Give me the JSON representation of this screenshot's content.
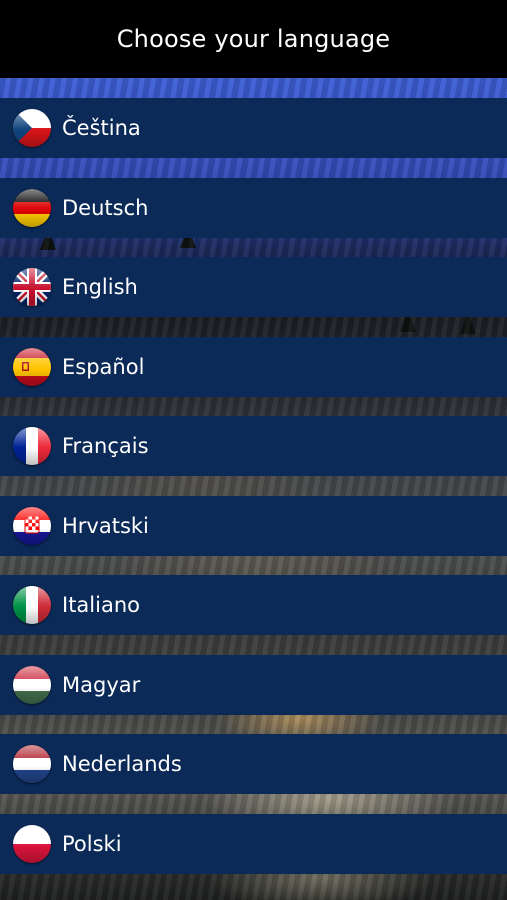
{
  "header": {
    "title": "Choose your language"
  },
  "languages": [
    {
      "label": "Čeština",
      "flag_icon": "czech-flag-icon"
    },
    {
      "label": "Deutsch",
      "flag_icon": "german-flag-icon"
    },
    {
      "label": "English",
      "flag_icon": "uk-flag-icon"
    },
    {
      "label": "Español",
      "flag_icon": "spanish-flag-icon"
    },
    {
      "label": "Français",
      "flag_icon": "french-flag-icon"
    },
    {
      "label": "Hrvatski",
      "flag_icon": "croatian-flag-icon"
    },
    {
      "label": "Italiano",
      "flag_icon": "italian-flag-icon"
    },
    {
      "label": "Magyar",
      "flag_icon": "hungarian-flag-icon"
    },
    {
      "label": "Nederlands",
      "flag_icon": "dutch-flag-icon"
    },
    {
      "label": "Polski",
      "flag_icon": "polish-flag-icon"
    }
  ],
  "colors": {
    "header_bg": "#000000",
    "item_bg": "#0b2a57",
    "text": "#ffffff",
    "sky": "#3d5fd6"
  }
}
